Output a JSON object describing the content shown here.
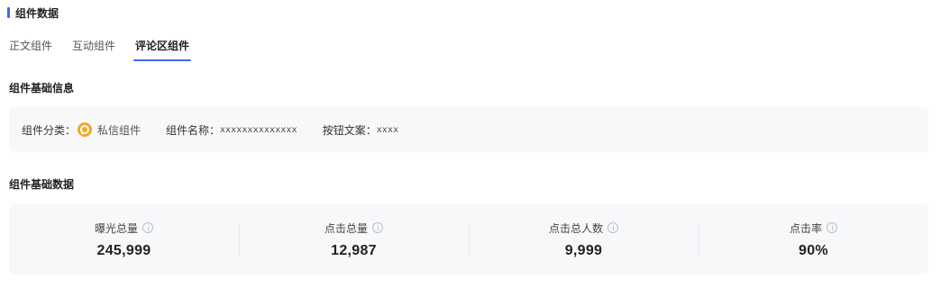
{
  "section": {
    "title": "组件数据",
    "accent_color": "#3d6cf0"
  },
  "tabs": [
    {
      "label": "正文组件",
      "active": false
    },
    {
      "label": "互动组件",
      "active": false
    },
    {
      "label": "评论区组件",
      "active": true
    }
  ],
  "basic_info": {
    "heading": "组件基础信息",
    "category_label": "组件分类：",
    "category_icon": "private-message-icon",
    "category_value": "私信组件",
    "name_label": "组件名称：",
    "name_value": "xxxxxxxxxxxxxx",
    "button_label": "按钮文案：",
    "button_value": "xxxx"
  },
  "basic_data": {
    "heading": "组件基础数据",
    "metrics": [
      {
        "label": "曝光总量",
        "value": "245,999"
      },
      {
        "label": "点击总量",
        "value": "12,987"
      },
      {
        "label": "点击总人数",
        "value": "9,999"
      },
      {
        "label": "点击率",
        "value": "90%"
      }
    ]
  }
}
